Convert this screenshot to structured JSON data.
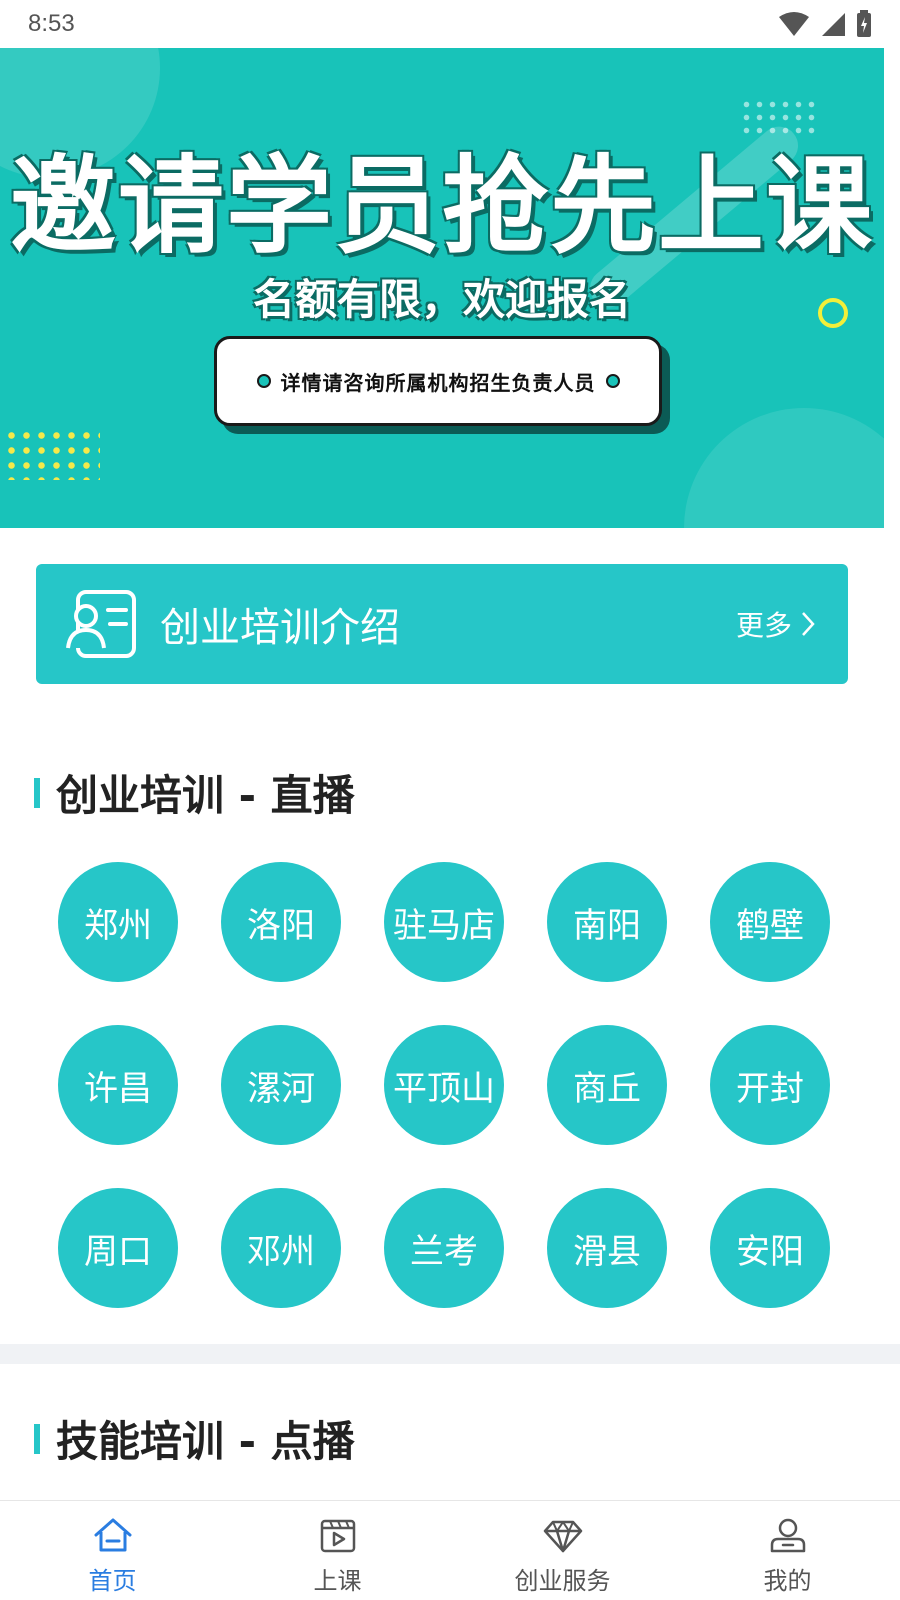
{
  "status_bar": {
    "time": "8:53"
  },
  "banner": {
    "title": "邀请学员抢先上课",
    "subtitle": "名额有限，欢迎报名",
    "pill_text": "详情请咨询所属机构招生负责人员"
  },
  "intro_card": {
    "title": "创业培训介绍",
    "more": "更多",
    "icon": "profile-card-icon"
  },
  "live_section": {
    "title": "创业培训 - 直播",
    "cities": [
      "郑州",
      "洛阳",
      "驻马店",
      "南阳",
      "鹤壁",
      "许昌",
      "漯河",
      "平顶山",
      "商丘",
      "开封",
      "周口",
      "邓州",
      "兰考",
      "滑县",
      "安阳"
    ]
  },
  "vod_section": {
    "title": "技能培训 - 点播"
  },
  "bottom_nav": {
    "items": [
      {
        "label": "首页",
        "icon": "home-icon",
        "active": true
      },
      {
        "label": "上课",
        "icon": "video-icon",
        "active": false
      },
      {
        "label": "创业服务",
        "icon": "diamond-icon",
        "active": false
      },
      {
        "label": "我的",
        "icon": "user-icon",
        "active": false
      }
    ]
  },
  "colors": {
    "accent": "#26c6c8",
    "banner": "#18c3b9",
    "active_nav": "#2a7de1"
  }
}
